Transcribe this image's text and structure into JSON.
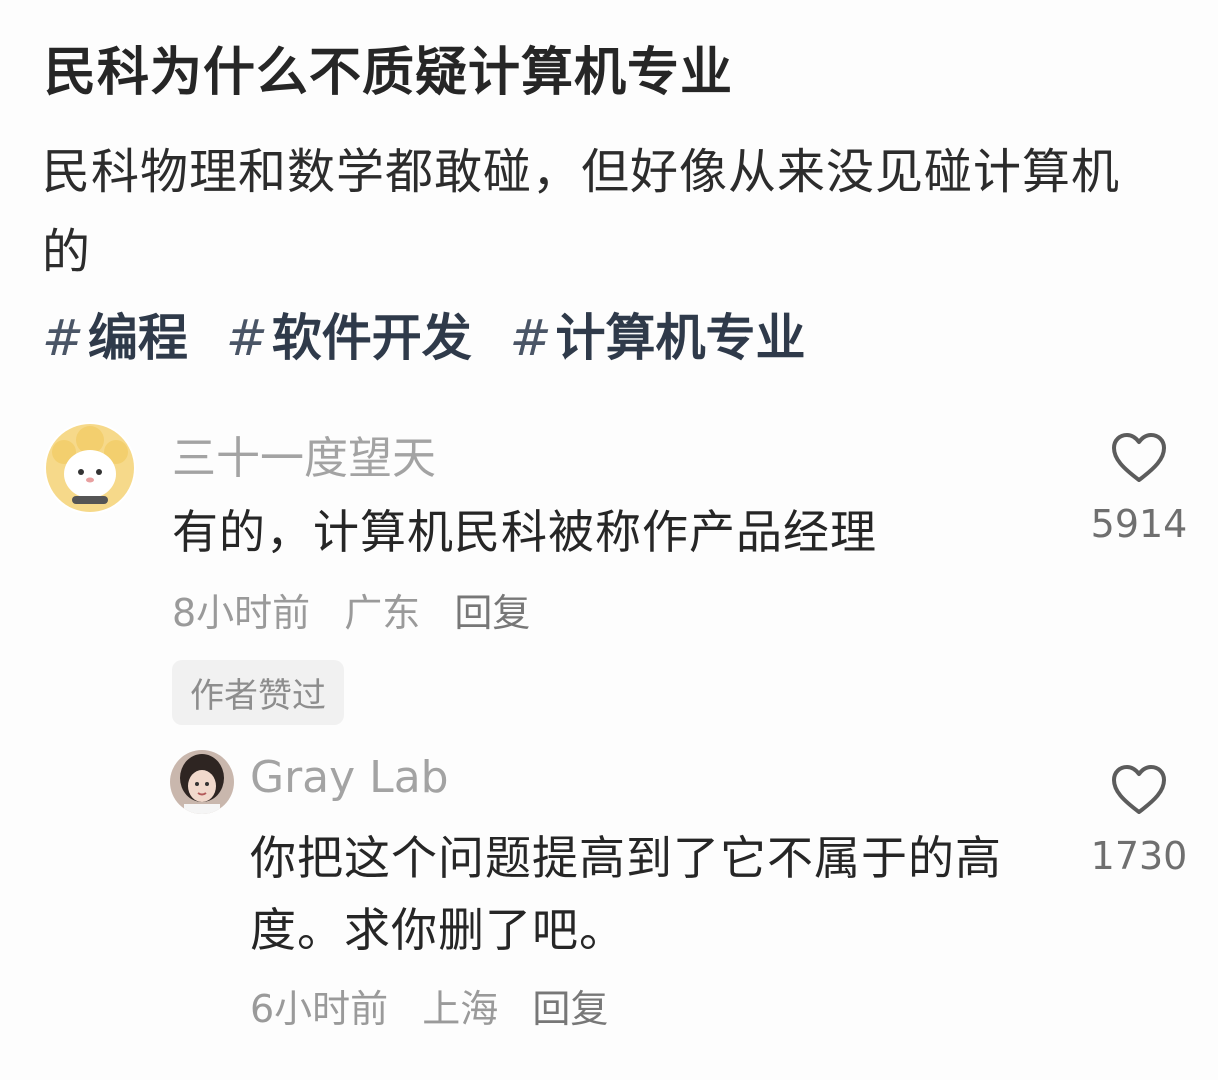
{
  "post": {
    "title": "民科为什么不质疑计算机专业",
    "body": "民科物理和数学都敢碰，但好像从来没见碰计算机的",
    "tags": [
      "编程",
      "软件开发",
      "计算机专业"
    ]
  },
  "comments": [
    {
      "username": "三十一度望天",
      "text": "有的，计算机民科被称作产品经理",
      "time": "8小时前",
      "location": "广东",
      "reply": "回复",
      "likes": "5914",
      "badge": "作者赞过",
      "avatar_icon": "cartoon-sheep-avatar-icon"
    },
    {
      "username": "Gray Lab",
      "text": "你把这个问题提高到了它不属于的高度。求你删了吧。",
      "time": "6小时前",
      "location": "上海",
      "reply": "回复",
      "likes": "1730",
      "avatar_icon": "profile-photo-avatar-icon"
    }
  ],
  "icons": {
    "like": "heart-outline-icon"
  },
  "colors": {
    "text_primary": "#262626",
    "text_secondary": "#9a9a9a",
    "badge_bg": "#f1f1f1"
  }
}
